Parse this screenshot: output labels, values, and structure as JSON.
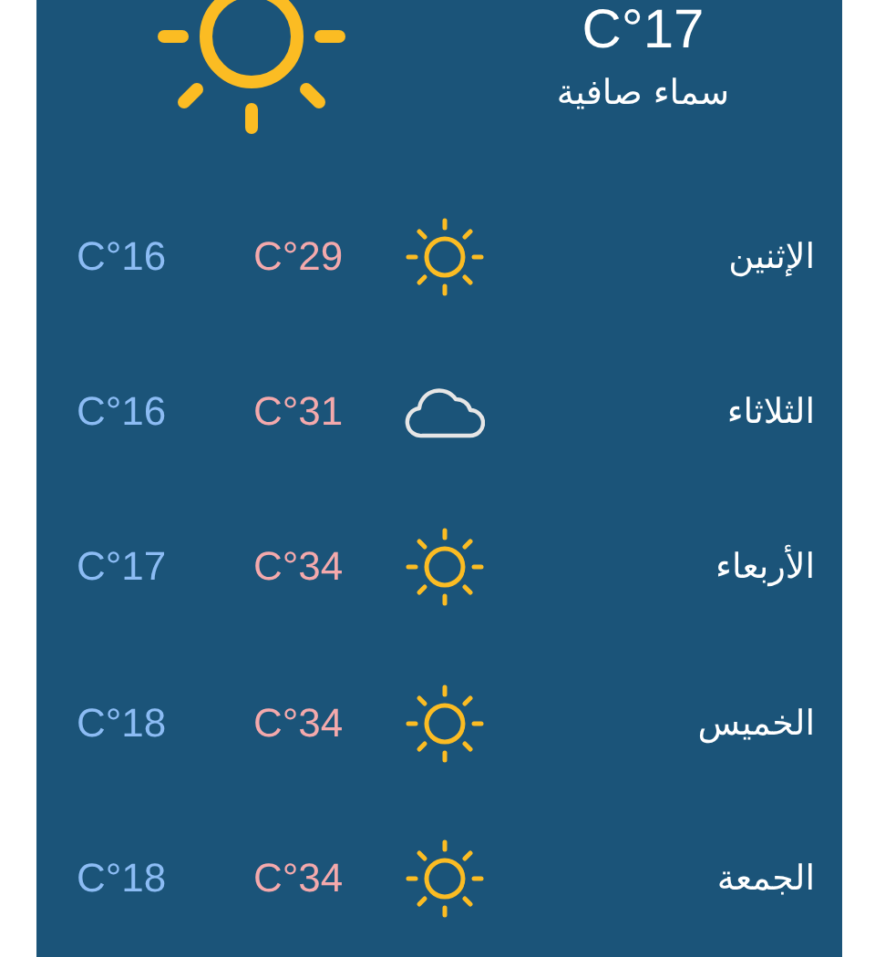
{
  "current": {
    "temperature": "C°17",
    "condition": "سماء صافية",
    "kind": "sun"
  },
  "forecast": [
    {
      "day": "الإثنين",
      "kind": "sun",
      "high": "C°29",
      "low": "C°16"
    },
    {
      "day": "الثلاثاء",
      "kind": "cloud",
      "high": "C°31",
      "low": "C°16"
    },
    {
      "day": "الأربعاء",
      "kind": "sun",
      "high": "C°34",
      "low": "C°17"
    },
    {
      "day": "الخميس",
      "kind": "sun",
      "high": "C°34",
      "low": "C°18"
    },
    {
      "day": "الجمعة",
      "kind": "sun",
      "high": "C°34",
      "low": "C°18"
    }
  ]
}
